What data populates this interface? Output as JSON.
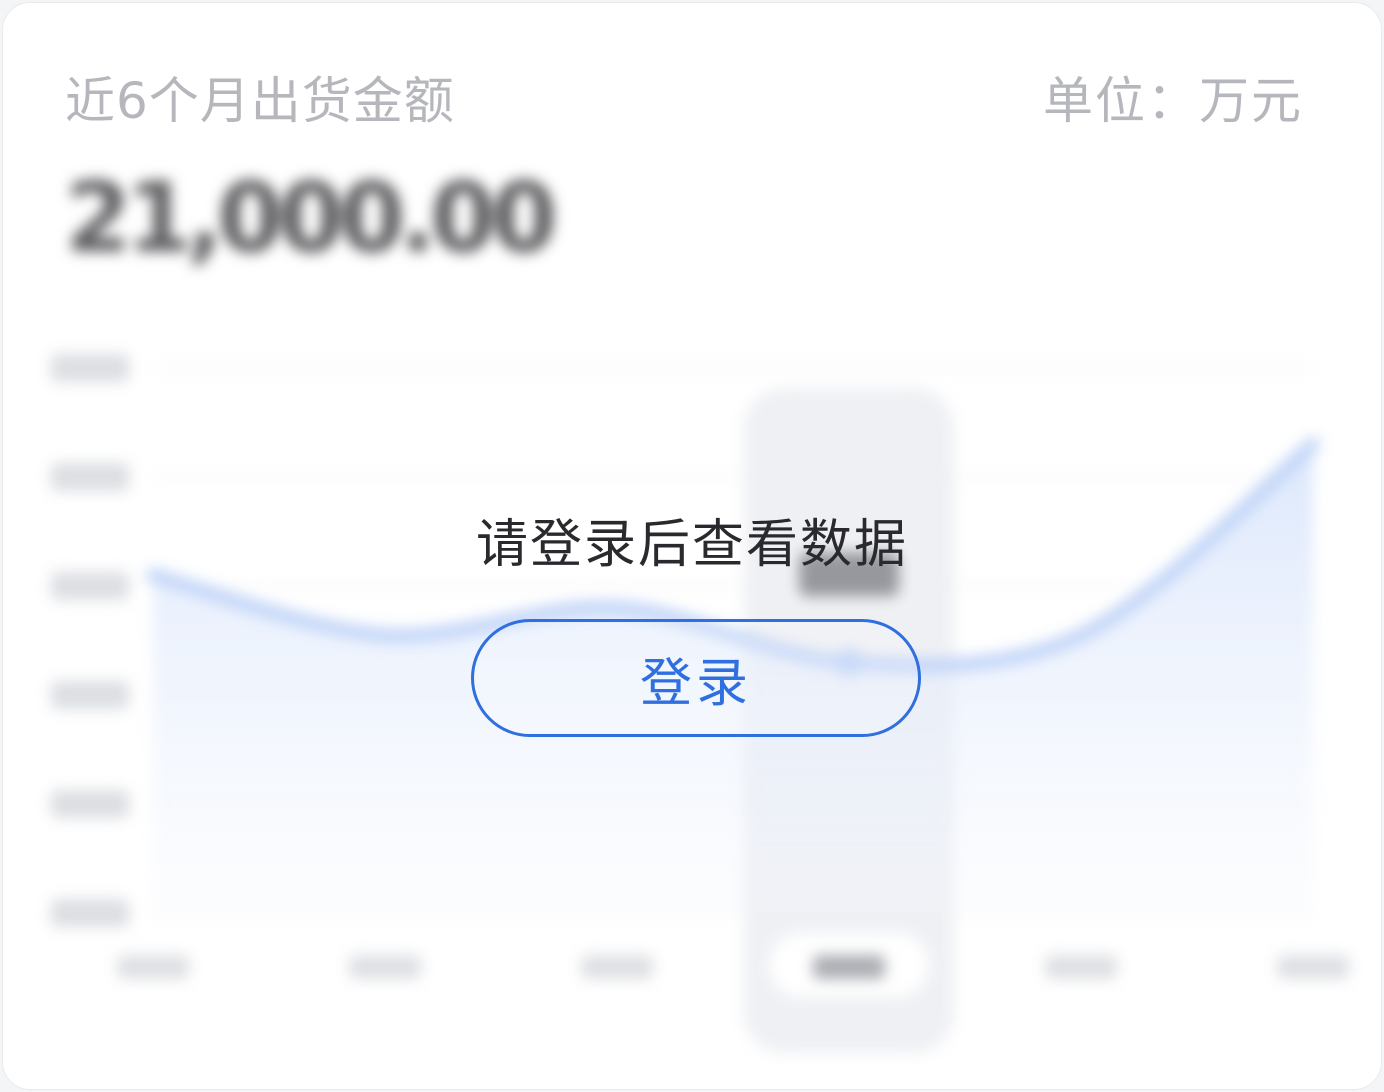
{
  "card": {
    "title": "近6个月出货金额",
    "unit": "单位：万元"
  },
  "blurred": {
    "total_value": "21,000.00"
  },
  "login": {
    "prompt": "请登录后查看数据",
    "button_label": "登录"
  },
  "colors": {
    "accent": "#2f6fe0",
    "line": "#a9c4f5",
    "title_gray": "#9a9ca2"
  },
  "chart_data": {
    "type": "area",
    "title": "",
    "xlabel": "",
    "ylabel": "",
    "categories": [
      "",
      "",
      "",
      "",
      "",
      ""
    ],
    "series": [
      {
        "values": [
          6.2,
          5.1,
          5.6,
          4.6,
          5.1,
          8.6
        ]
      }
    ],
    "ylim": [
      0,
      10
    ],
    "grid": true,
    "highlighted_index": 3
  }
}
